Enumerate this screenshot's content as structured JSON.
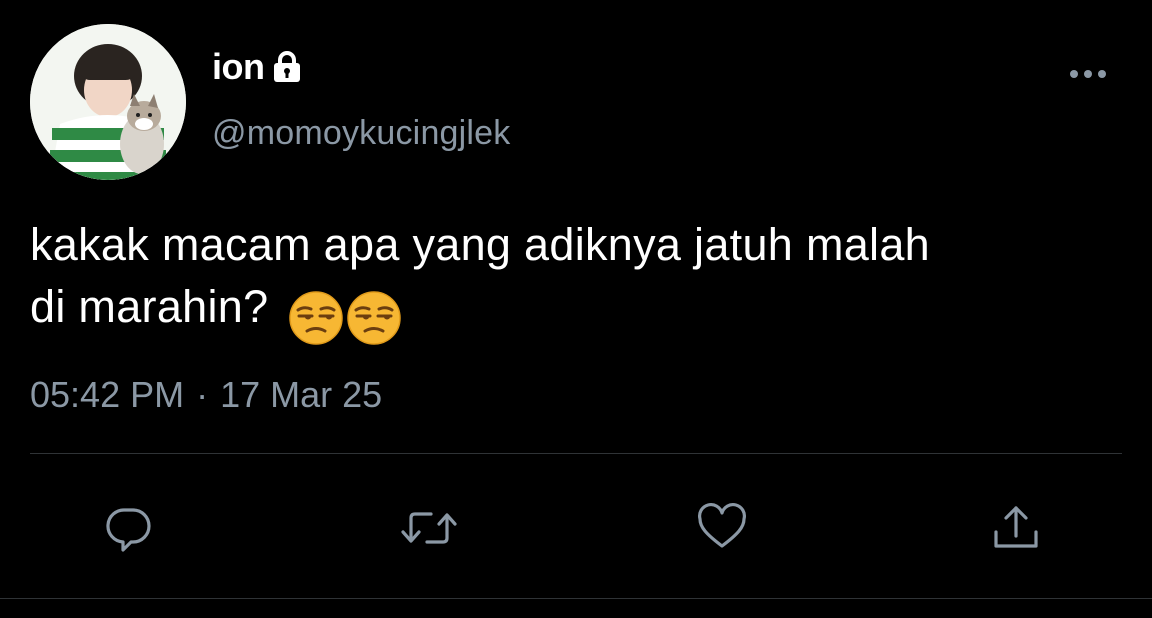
{
  "tweet": {
    "author": {
      "display_name": "ion",
      "handle": "@momoykucingjlek",
      "protected": true,
      "avatar_description_icon": "avatar-photo"
    },
    "text_line1": "kakak macam apa yang adiknya jatuh malah",
    "text_line2": "di marahin?",
    "emoji": [
      "unamused-face",
      "unamused-face"
    ],
    "time": "05:42 PM",
    "separator": "·",
    "date": "17 Mar 25"
  },
  "actions": {
    "icons": [
      "reply-icon",
      "retweet-icon",
      "like-icon",
      "share-icon"
    ]
  },
  "colors": {
    "background": "#000000",
    "text_primary": "#ffffff",
    "text_secondary": "#8b98a5",
    "divider": "#2f3336",
    "emoji_yellow": "#f7b733"
  }
}
